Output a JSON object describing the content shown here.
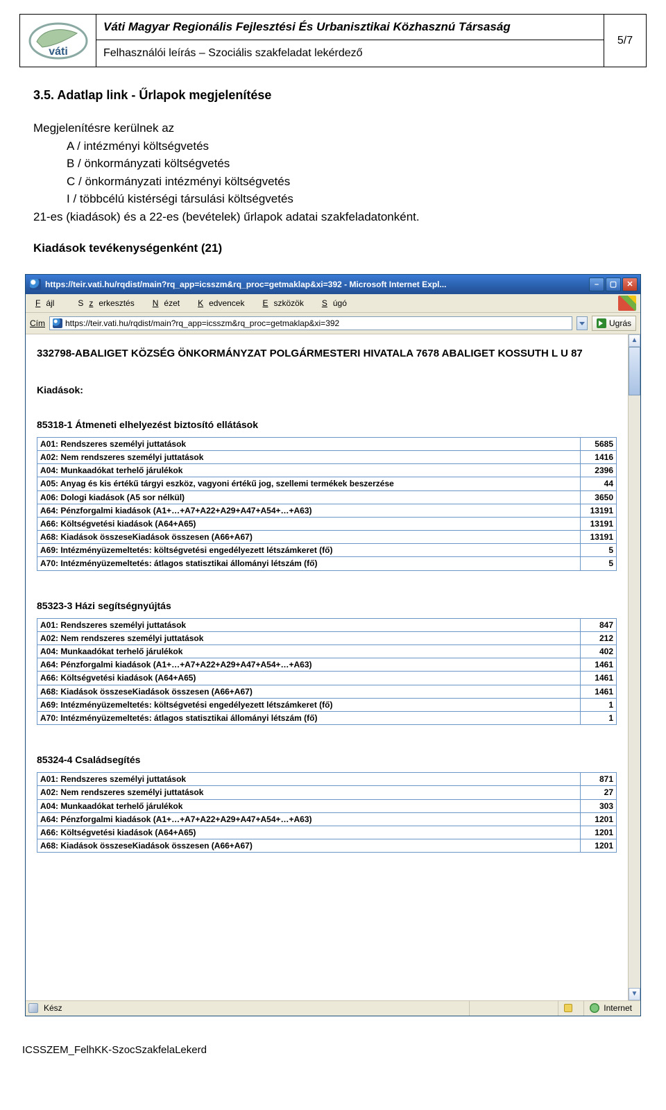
{
  "header": {
    "org": "Váti Magyar Regionális Fejlesztési És Urbanisztikai Közhasznú Társaság",
    "subtitle": "Felhasználói leírás – Szociális szakfeladat lekérdező",
    "page_no": "5/7",
    "logo_text": "váti"
  },
  "section": {
    "title": "3.5.  Adatlap link - Űrlapok megjelenítése",
    "lead": "Megjelenítésre kerülnek az",
    "items": [
      "A / intézményi költségvetés",
      "B / önkormányzati költségvetés",
      "C / önkormányzati intézményi költségvetés",
      "I  / többcélú kistérségi társulási költségvetés"
    ],
    "tail": "21-es (kiadások) és a 22-es (bevételek) űrlapok adatai szakfeladatonként.",
    "kiad_title": "Kiadások tevékenységenként (21)"
  },
  "ie": {
    "title": "https://teir.vati.hu/rqdist/main?rq_app=icsszm&rq_proc=getmaklap&xi=392 - Microsoft Internet Expl...",
    "menu": {
      "file": "Fájl",
      "edit": "Szerkesztés",
      "view": "Nézet",
      "fav": "Kedvencek",
      "tools": "Eszközök",
      "help": "Súgó"
    },
    "addr_label": "Cím",
    "addr_value": "https://teir.vati.hu/rqdist/main?rq_app=icsszm&rq_proc=getmaklap&xi=392",
    "go_label": "Ugrás",
    "status_ready": "Kész",
    "status_zone": "Internet"
  },
  "page": {
    "heading": "332798-ABALIGET KÖZSÉG ÖNKORMÁNYZAT POLGÁRMESTERI HIVATALA 7678 ABALIGET KOSSUTH L U 87",
    "kiad_label": "Kiadások:",
    "blocks": [
      {
        "title": "85318-1 Átmeneti elhelyezést biztosító ellátások",
        "rows": [
          [
            "A01: Rendszeres személyi juttatások",
            "5685"
          ],
          [
            "A02: Nem rendszeres személyi juttatások",
            "1416"
          ],
          [
            "A04: Munkaadókat terhelő járulékok",
            "2396"
          ],
          [
            "A05: Anyag és kis értékű tárgyi eszköz, vagyoni értékű jog, szellemi termékek beszerzése",
            "44"
          ],
          [
            "A06: Dologi kiadások (A5 sor nélkül)",
            "3650"
          ],
          [
            "A64: Pénzforgalmi kiadások (A1+…+A7+A22+A29+A47+A54+…+A63)",
            "13191"
          ],
          [
            "A66: Költségvetési kiadások (A64+A65)",
            "13191"
          ],
          [
            "A68: Kiadások összeseKiadások összesen (A66+A67)",
            "13191"
          ],
          [
            "A69: Intézményüzemeltetés: költségvetési engedélyezett létszámkeret (fő)",
            "5"
          ],
          [
            "A70: Intézményüzemeltetés: átlagos statisztikai állományi létszám (fő)",
            "5"
          ]
        ]
      },
      {
        "title": "85323-3 Házi segítségnyújtás",
        "rows": [
          [
            "A01: Rendszeres személyi juttatások",
            "847"
          ],
          [
            "A02: Nem rendszeres személyi juttatások",
            "212"
          ],
          [
            "A04: Munkaadókat terhelő járulékok",
            "402"
          ],
          [
            "A64: Pénzforgalmi kiadások (A1+…+A7+A22+A29+A47+A54+…+A63)",
            "1461"
          ],
          [
            "A66: Költségvetési kiadások (A64+A65)",
            "1461"
          ],
          [
            "A68: Kiadások összeseKiadások összesen (A66+A67)",
            "1461"
          ],
          [
            "A69: Intézményüzemeltetés: költségvetési engedélyezett létszámkeret (fő)",
            "1"
          ],
          [
            "A70: Intézményüzemeltetés: átlagos statisztikai állományi létszám (fő)",
            "1"
          ]
        ]
      },
      {
        "title": "85324-4 Családsegítés",
        "rows": [
          [
            "A01: Rendszeres személyi juttatások",
            "871"
          ],
          [
            "A02: Nem rendszeres személyi juttatások",
            "27"
          ],
          [
            "A04: Munkaadókat terhelő járulékok",
            "303"
          ],
          [
            "A64: Pénzforgalmi kiadások (A1+…+A7+A22+A29+A47+A54+…+A63)",
            "1201"
          ],
          [
            "A66: Költségvetési kiadások (A64+A65)",
            "1201"
          ],
          [
            "A68: Kiadások összeseKiadások összesen (A66+A67)",
            "1201"
          ]
        ]
      }
    ]
  },
  "footer_code": "ICSSZEM_FelhKK-SzocSzakfelaLekerd"
}
